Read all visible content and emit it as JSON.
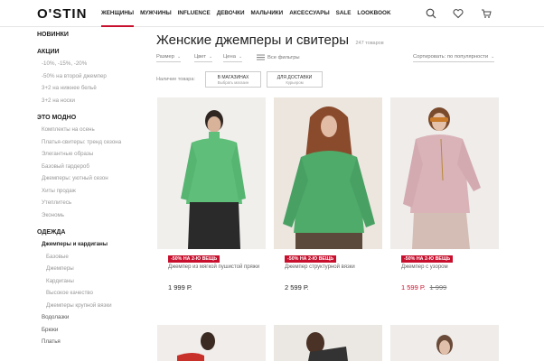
{
  "header": {
    "logo": "O'STIN",
    "nav": [
      "ЖЕНЩИНЫ",
      "МУЖЧИНЫ",
      "INFLUENCE",
      "ДЕВОЧКИ",
      "МАЛЬЧИКИ",
      "АКСЕССУАРЫ",
      "SALE",
      "LOOKBOOK"
    ],
    "active_index": 0,
    "icons": [
      "search-icon",
      "heart-icon",
      "cart-icon"
    ]
  },
  "sidebar": {
    "new": "НОВИНКИ",
    "promo_head": "АКЦИИ",
    "promo_items": [
      "-10%, -15%, -20%",
      "-50% на второй джемпер",
      "3+2 на нижнее бельё",
      "3+2 на носки"
    ],
    "trend_head": "ЭТО МОДНО",
    "trend_items": [
      "Комплекты на осень",
      "Платья-свитеры: тренд сезона",
      "Элегантные образы",
      "Базовый гардероб",
      "Джемперы: уютный сезон",
      "Хиты продаж",
      "Утеплитесь",
      "Экономь"
    ],
    "clothes_head": "ОДЕЖДА",
    "clothes_active": "Джемперы и кардиганы",
    "clothes_sub": [
      "Базовые",
      "Джемперы",
      "Кардиганы",
      "Высокое качество",
      "Джемперы крупной вязки"
    ],
    "clothes_items": [
      "Водолазки",
      "Брюки",
      "Платья"
    ]
  },
  "main": {
    "title": "Женские джемперы и свитеры",
    "count": "247 товаров",
    "filters": [
      "Размер",
      "Цвет",
      "Цена",
      "Все фильтры"
    ],
    "sort": "Сортировать: по популярности",
    "availability_label": "Наличие товара:",
    "buttons": [
      {
        "label": "В МАГАЗИНАХ",
        "sub": "Выбрать магазин"
      },
      {
        "label": "ДЛЯ ДОСТАВКИ",
        "sub": "Курьером"
      }
    ]
  },
  "products": [
    {
      "badge": "-50% НА 2-Ю ВЕЩЬ",
      "name": "Джемпер из мягкой пушистой пряжи",
      "price": "1 999 Р.",
      "old_price": "",
      "sale": false
    },
    {
      "badge": "-50% НА 2-Ю ВЕЩЬ",
      "name": "Джемпер структурной вязки",
      "price": "2 599 Р.",
      "old_price": "",
      "sale": false
    },
    {
      "badge": "-50% НА 2-Ю ВЕЩЬ",
      "name": "Джемпер с узором",
      "price": "1 599 Р.",
      "old_price": "1 999",
      "sale": true
    }
  ],
  "colors": {
    "accent": "#c8102e",
    "green": "#5fbf7a",
    "pink": "#d9b3b8"
  }
}
